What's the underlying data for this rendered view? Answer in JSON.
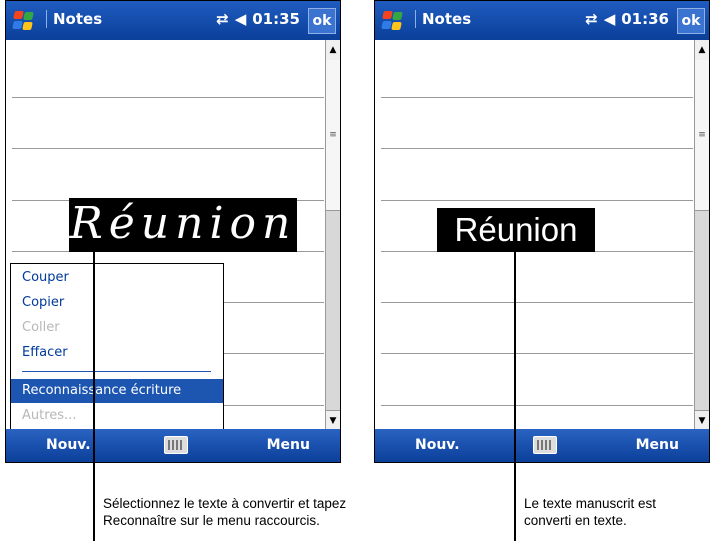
{
  "left_screen": {
    "title": "Notes",
    "time": "01:35",
    "ok": "ok",
    "ink_word": "Réunion",
    "menu": {
      "items": [
        {
          "label": "Couper"
        },
        {
          "label": "Copier"
        },
        {
          "label": "Coller"
        },
        {
          "label": "Effacer"
        },
        {
          "label": "Reconnaissance écriture"
        },
        {
          "label": "Autres..."
        }
      ]
    },
    "cmd_new": "Nouv.",
    "cmd_menu": "Menu"
  },
  "right_screen": {
    "title": "Notes",
    "time": "01:36",
    "ok": "ok",
    "converted_word": "Réunion",
    "cmd_new": "Nouv.",
    "cmd_menu": "Menu"
  },
  "captions": {
    "left_line1": "Sélectionnez le texte à convertir et tapez",
    "left_line2": "Reconnaître sur le menu raccourcis.",
    "right_line1": "Le texte manuscrit est",
    "right_line2": "converti en texte."
  }
}
